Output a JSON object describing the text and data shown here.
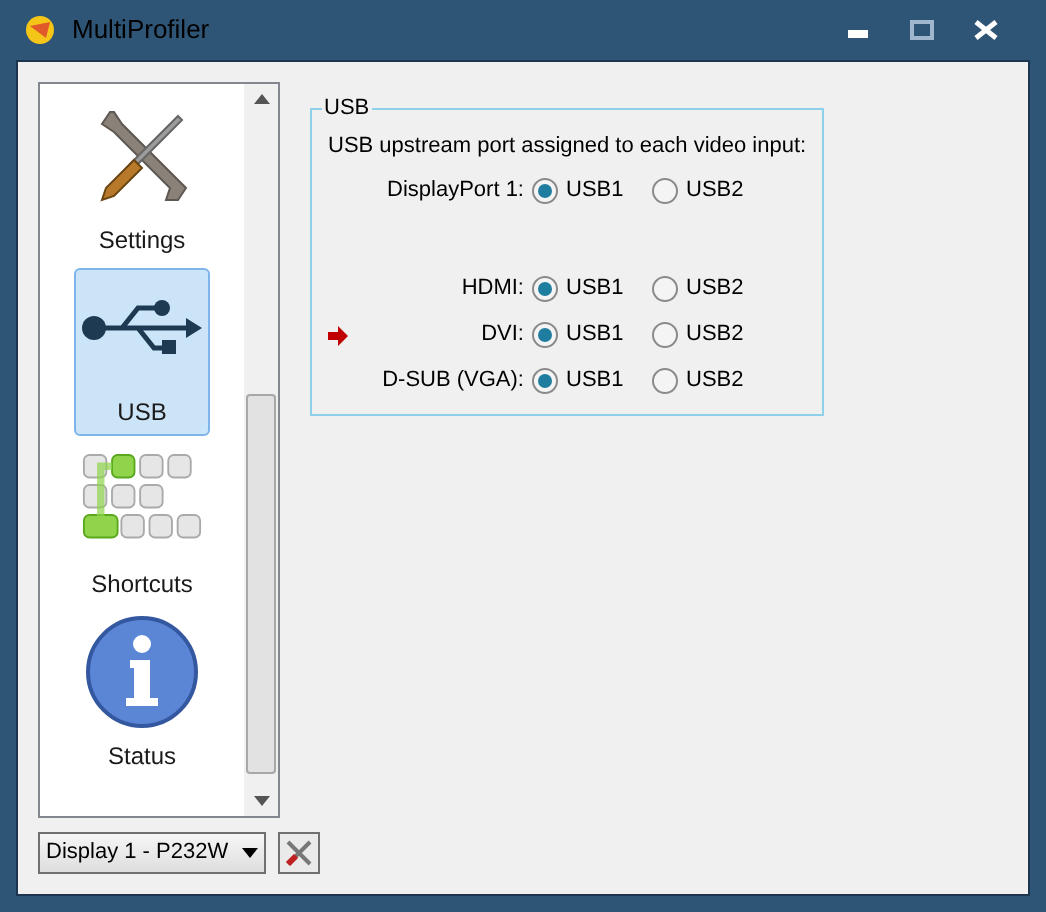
{
  "window": {
    "title": "MultiProfiler"
  },
  "sidebar": {
    "items": [
      {
        "kind": "settings",
        "label": "Settings",
        "selected": false
      },
      {
        "kind": "usb",
        "label": "USB",
        "selected": true
      },
      {
        "kind": "shortcuts",
        "label": "Shortcuts",
        "selected": false
      },
      {
        "kind": "status",
        "label": "Status",
        "selected": false
      }
    ]
  },
  "usb_group": {
    "title": "USB",
    "description": "USB upstream port assigned to each video input:",
    "input_groups": [
      [
        {
          "input": "DisplayPort 1:",
          "current": false,
          "options": [
            {
              "label": "USB1",
              "selected": true
            },
            {
              "label": "USB2",
              "selected": false
            }
          ]
        }
      ],
      [
        {
          "input": "HDMI:",
          "current": false,
          "options": [
            {
              "label": "USB1",
              "selected": true
            },
            {
              "label": "USB2",
              "selected": false
            }
          ]
        },
        {
          "input": "DVI:",
          "current": true,
          "options": [
            {
              "label": "USB1",
              "selected": true
            },
            {
              "label": "USB2",
              "selected": false
            }
          ]
        },
        {
          "input": "D-SUB (VGA):",
          "current": false,
          "options": [
            {
              "label": "USB1",
              "selected": true
            },
            {
              "label": "USB2",
              "selected": false
            }
          ]
        }
      ]
    ]
  },
  "display_select": {
    "value": "Display 1 - P232W"
  }
}
